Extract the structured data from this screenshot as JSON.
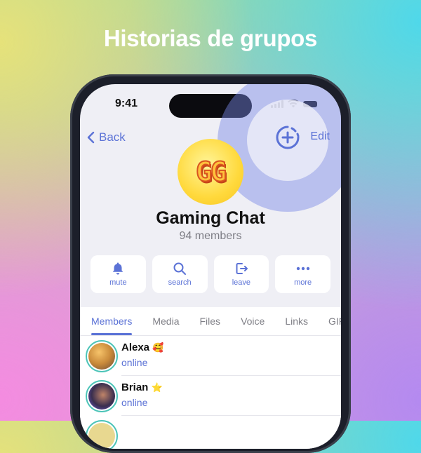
{
  "headline": "Historias de grupos",
  "status_bar": {
    "time": "9:41"
  },
  "nav": {
    "back_label": "Back",
    "edit_label": "Edit",
    "story_add_icon": "add-story-icon"
  },
  "group": {
    "avatar_text": "GG",
    "name": "Gaming Chat",
    "subtitle": "94 members"
  },
  "actions": [
    {
      "label": "mute",
      "icon": "bell-icon"
    },
    {
      "label": "search",
      "icon": "search-icon"
    },
    {
      "label": "leave",
      "icon": "leave-icon"
    },
    {
      "label": "more",
      "icon": "more-icon"
    }
  ],
  "tabs": [
    {
      "label": "Members",
      "active": true
    },
    {
      "label": "Media"
    },
    {
      "label": "Files"
    },
    {
      "label": "Voice"
    },
    {
      "label": "Links"
    },
    {
      "label": "GIFs"
    }
  ],
  "members": [
    {
      "name": "Alexa",
      "emoji": "🥰",
      "status": "online"
    },
    {
      "name": "Brian",
      "emoji": "⭐",
      "status": "online"
    }
  ],
  "colors": {
    "accent": "#5b72d6",
    "story_ring": "#4cc4b8"
  }
}
